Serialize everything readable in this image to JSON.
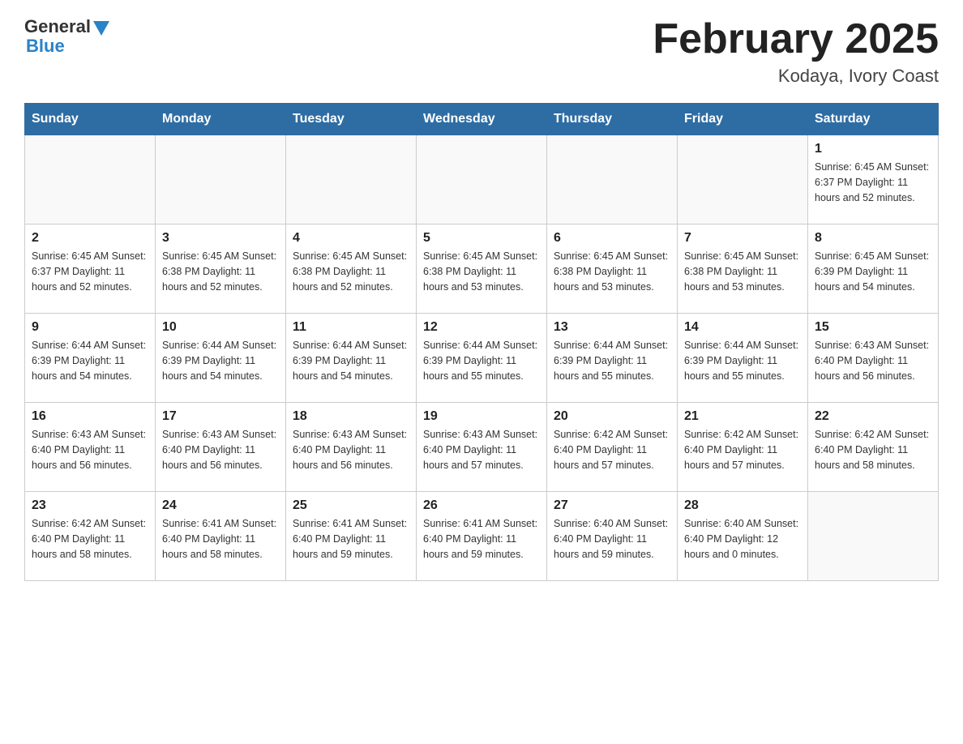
{
  "logo": {
    "general": "General",
    "blue": "Blue"
  },
  "title": {
    "month_year": "February 2025",
    "location": "Kodaya, Ivory Coast"
  },
  "weekdays": [
    "Sunday",
    "Monday",
    "Tuesday",
    "Wednesday",
    "Thursday",
    "Friday",
    "Saturday"
  ],
  "weeks": [
    [
      {
        "day": "",
        "info": ""
      },
      {
        "day": "",
        "info": ""
      },
      {
        "day": "",
        "info": ""
      },
      {
        "day": "",
        "info": ""
      },
      {
        "day": "",
        "info": ""
      },
      {
        "day": "",
        "info": ""
      },
      {
        "day": "1",
        "info": "Sunrise: 6:45 AM\nSunset: 6:37 PM\nDaylight: 11 hours\nand 52 minutes."
      }
    ],
    [
      {
        "day": "2",
        "info": "Sunrise: 6:45 AM\nSunset: 6:37 PM\nDaylight: 11 hours\nand 52 minutes."
      },
      {
        "day": "3",
        "info": "Sunrise: 6:45 AM\nSunset: 6:38 PM\nDaylight: 11 hours\nand 52 minutes."
      },
      {
        "day": "4",
        "info": "Sunrise: 6:45 AM\nSunset: 6:38 PM\nDaylight: 11 hours\nand 52 minutes."
      },
      {
        "day": "5",
        "info": "Sunrise: 6:45 AM\nSunset: 6:38 PM\nDaylight: 11 hours\nand 53 minutes."
      },
      {
        "day": "6",
        "info": "Sunrise: 6:45 AM\nSunset: 6:38 PM\nDaylight: 11 hours\nand 53 minutes."
      },
      {
        "day": "7",
        "info": "Sunrise: 6:45 AM\nSunset: 6:38 PM\nDaylight: 11 hours\nand 53 minutes."
      },
      {
        "day": "8",
        "info": "Sunrise: 6:45 AM\nSunset: 6:39 PM\nDaylight: 11 hours\nand 54 minutes."
      }
    ],
    [
      {
        "day": "9",
        "info": "Sunrise: 6:44 AM\nSunset: 6:39 PM\nDaylight: 11 hours\nand 54 minutes."
      },
      {
        "day": "10",
        "info": "Sunrise: 6:44 AM\nSunset: 6:39 PM\nDaylight: 11 hours\nand 54 minutes."
      },
      {
        "day": "11",
        "info": "Sunrise: 6:44 AM\nSunset: 6:39 PM\nDaylight: 11 hours\nand 54 minutes."
      },
      {
        "day": "12",
        "info": "Sunrise: 6:44 AM\nSunset: 6:39 PM\nDaylight: 11 hours\nand 55 minutes."
      },
      {
        "day": "13",
        "info": "Sunrise: 6:44 AM\nSunset: 6:39 PM\nDaylight: 11 hours\nand 55 minutes."
      },
      {
        "day": "14",
        "info": "Sunrise: 6:44 AM\nSunset: 6:39 PM\nDaylight: 11 hours\nand 55 minutes."
      },
      {
        "day": "15",
        "info": "Sunrise: 6:43 AM\nSunset: 6:40 PM\nDaylight: 11 hours\nand 56 minutes."
      }
    ],
    [
      {
        "day": "16",
        "info": "Sunrise: 6:43 AM\nSunset: 6:40 PM\nDaylight: 11 hours\nand 56 minutes."
      },
      {
        "day": "17",
        "info": "Sunrise: 6:43 AM\nSunset: 6:40 PM\nDaylight: 11 hours\nand 56 minutes."
      },
      {
        "day": "18",
        "info": "Sunrise: 6:43 AM\nSunset: 6:40 PM\nDaylight: 11 hours\nand 56 minutes."
      },
      {
        "day": "19",
        "info": "Sunrise: 6:43 AM\nSunset: 6:40 PM\nDaylight: 11 hours\nand 57 minutes."
      },
      {
        "day": "20",
        "info": "Sunrise: 6:42 AM\nSunset: 6:40 PM\nDaylight: 11 hours\nand 57 minutes."
      },
      {
        "day": "21",
        "info": "Sunrise: 6:42 AM\nSunset: 6:40 PM\nDaylight: 11 hours\nand 57 minutes."
      },
      {
        "day": "22",
        "info": "Sunrise: 6:42 AM\nSunset: 6:40 PM\nDaylight: 11 hours\nand 58 minutes."
      }
    ],
    [
      {
        "day": "23",
        "info": "Sunrise: 6:42 AM\nSunset: 6:40 PM\nDaylight: 11 hours\nand 58 minutes."
      },
      {
        "day": "24",
        "info": "Sunrise: 6:41 AM\nSunset: 6:40 PM\nDaylight: 11 hours\nand 58 minutes."
      },
      {
        "day": "25",
        "info": "Sunrise: 6:41 AM\nSunset: 6:40 PM\nDaylight: 11 hours\nand 59 minutes."
      },
      {
        "day": "26",
        "info": "Sunrise: 6:41 AM\nSunset: 6:40 PM\nDaylight: 11 hours\nand 59 minutes."
      },
      {
        "day": "27",
        "info": "Sunrise: 6:40 AM\nSunset: 6:40 PM\nDaylight: 11 hours\nand 59 minutes."
      },
      {
        "day": "28",
        "info": "Sunrise: 6:40 AM\nSunset: 6:40 PM\nDaylight: 12 hours\nand 0 minutes."
      },
      {
        "day": "",
        "info": ""
      }
    ]
  ]
}
